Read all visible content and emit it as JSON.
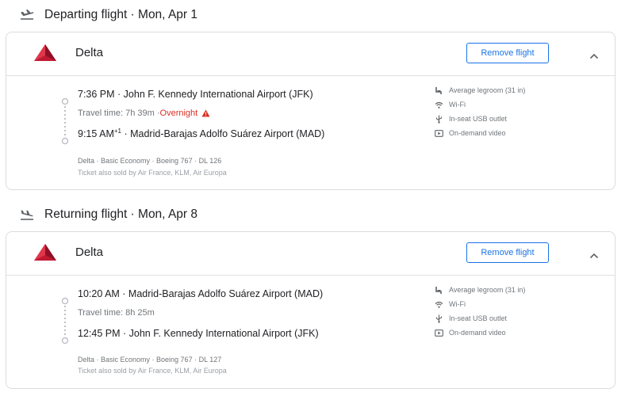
{
  "departing": {
    "title": "Departing flight · Mon, Apr 1",
    "airline": "Delta",
    "remove_label": "Remove flight",
    "depart": "7:36 PM · John F. Kennedy International Airport (JFK)",
    "travel_time": "Travel time: 7h 39m · ",
    "overnight": "Overnight",
    "arrive_time": "9:15 AM",
    "arrive_day_offset": "+1",
    "arrive_rest": " · Madrid-Barajas Adolfo Suárez Airport (MAD)",
    "details": "Delta · Basic Economy · Boeing 767 · DL 126",
    "codeshare": "Ticket also sold by Air France, KLM, Air Europa",
    "amenities": [
      "Average legroom (31 in)",
      "Wi-Fi",
      "In-seat USB outlet",
      "On-demand video"
    ]
  },
  "returning": {
    "title": "Returning flight · Mon, Apr 8",
    "airline": "Delta",
    "remove_label": "Remove flight",
    "depart": "10:20 AM · Madrid-Barajas Adolfo Suárez Airport (MAD)",
    "travel_time": "Travel time: 8h 25m",
    "arrive": "12:45 PM · John F. Kennedy International Airport (JFK)",
    "details": "Delta · Basic Economy · Boeing 767 · DL 127",
    "codeshare": "Ticket also sold by Air France, KLM, Air Europa",
    "amenities": [
      "Average legroom (31 in)",
      "Wi-Fi",
      "In-seat USB outlet",
      "On-demand video"
    ]
  },
  "colors": {
    "accent": "#1a73e8",
    "warning": "#d93025",
    "delta_red": "#c01933"
  }
}
